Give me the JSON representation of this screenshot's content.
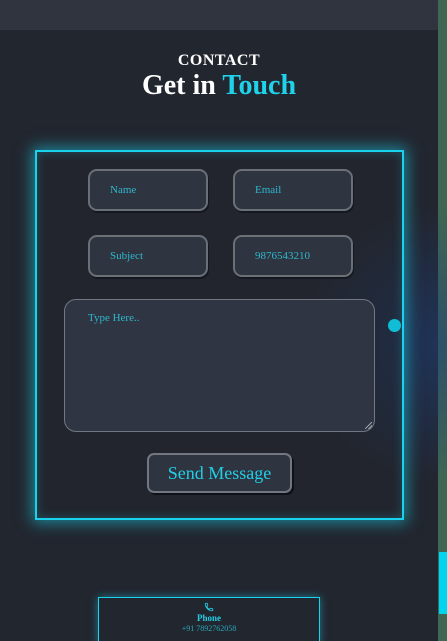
{
  "header": {
    "eyebrow": "CONTACT",
    "title_main": "Get in",
    "title_accent": "Touch"
  },
  "form": {
    "name_placeholder": "Name",
    "email_placeholder": "Email",
    "subject_placeholder": "Subject",
    "phone_value": "9876543210",
    "message_placeholder": "Type Here..",
    "submit_label": "Send Message"
  },
  "contact_card": {
    "icon": "phone-icon",
    "label": "Phone",
    "number": "+91 7892762058"
  },
  "colors": {
    "accent": "#1fd2ea",
    "background": "#22262f",
    "field": "#2f3441"
  }
}
